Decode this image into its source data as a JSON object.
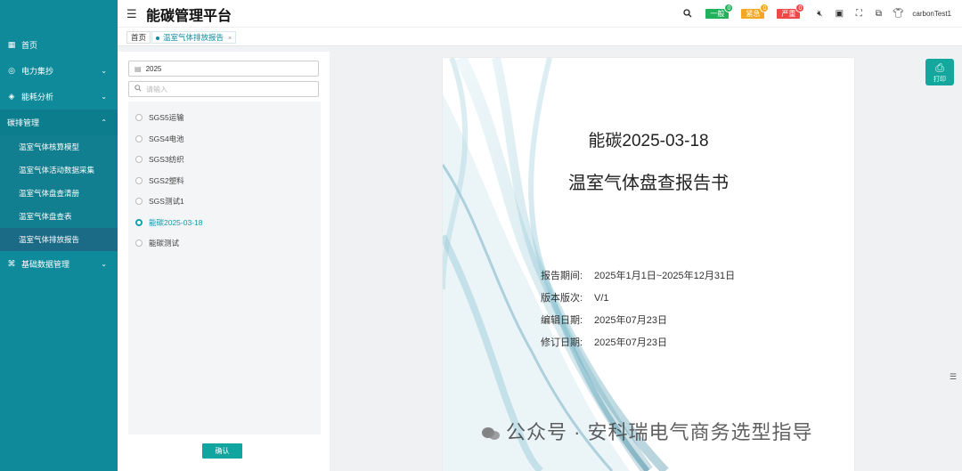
{
  "app": {
    "title": "能碳管理平台"
  },
  "header": {
    "alerts": [
      {
        "label": "一般",
        "count": "0",
        "color": "#20b15a"
      },
      {
        "label": "紧急",
        "count": "0",
        "color": "#f5a623"
      },
      {
        "label": "严重",
        "count": "0",
        "color": "#f04848"
      }
    ],
    "username": "carbonTest1"
  },
  "sidebar": {
    "items": [
      {
        "label": "首页"
      },
      {
        "label": "电力集抄"
      },
      {
        "label": "能耗分析"
      },
      {
        "label": "碳排管理"
      },
      {
        "label": "基础数据管理"
      }
    ],
    "carbon_submenu": [
      {
        "label": "温室气体核算模型"
      },
      {
        "label": "温室气体活动数据采集"
      },
      {
        "label": "温室气体盘查清册"
      },
      {
        "label": "温室气体盘查表"
      },
      {
        "label": "温室气体排放报告"
      }
    ]
  },
  "tabs": {
    "home": "首页",
    "current": "温室气体排放报告",
    "close": "×"
  },
  "filter": {
    "year": "2025",
    "search_placeholder": "请输入"
  },
  "reports": [
    {
      "name": "SGS5运输",
      "selected": false
    },
    {
      "name": "SGS4电池",
      "selected": false
    },
    {
      "name": "SGS3纺织",
      "selected": false
    },
    {
      "name": "SGS2塑料",
      "selected": false
    },
    {
      "name": "SGS测试1",
      "selected": false
    },
    {
      "name": "能碳2025-03-18",
      "selected": true
    },
    {
      "name": "能碳测试",
      "selected": false
    }
  ],
  "confirm_label": "确认",
  "document": {
    "title": "能碳2025-03-18",
    "subtitle": "温室气体盘查报告书",
    "meta": [
      {
        "label": "报告期间:",
        "value": "2025年1月1日~2025年12月31日"
      },
      {
        "label": "版本版次:",
        "value": "V/1"
      },
      {
        "label": "编辑日期:",
        "value": "2025年07月23日"
      },
      {
        "label": "修订日期:",
        "value": "2025年07月23日"
      }
    ]
  },
  "print_label": "打印",
  "watermark": "公众号 · 安科瑞电气商务选型指导"
}
